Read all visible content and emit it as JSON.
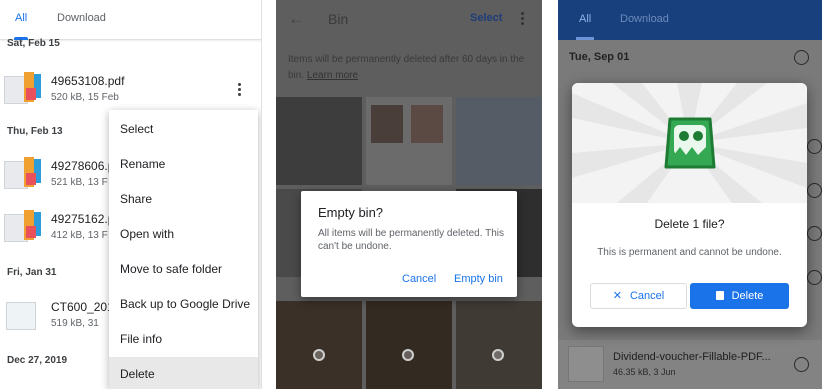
{
  "panel1": {
    "tabs": {
      "all": "All",
      "download": "Download"
    },
    "sections": [
      {
        "date": "Sat, Feb 15"
      },
      {
        "date": "Thu, Feb 13"
      },
      {
        "date": "Fri, Jan 31"
      },
      {
        "date": "Dec 27, 2019"
      }
    ],
    "files": [
      {
        "name": "49653108.pdf",
        "meta": "520 kB, 15 Feb"
      },
      {
        "name": "49278606.p",
        "meta": "521 kB, 13 F"
      },
      {
        "name": "49275162.p",
        "meta": "412 kB, 13 F"
      },
      {
        "name": "CT600_201",
        "meta": "519 kB, 31"
      }
    ],
    "menu": [
      "Select",
      "Rename",
      "Share",
      "Open with",
      "Move to safe folder",
      "Back up to Google Drive",
      "File info",
      "Delete"
    ]
  },
  "panel2": {
    "title": "Bin",
    "select": "Select",
    "note": "Items will be permanently deleted after 60 days in the bin.",
    "learn_more": "Learn more",
    "dialog": {
      "title": "Empty bin?",
      "body": "All items will be permanently deleted. This can't be undone.",
      "cancel": "Cancel",
      "confirm": "Empty bin"
    }
  },
  "panel3": {
    "tabs": {
      "all": "All",
      "download": "Download"
    },
    "date": "Tue, Sep 01",
    "file": {
      "name": "Dividend-voucher-Fillable-PDF...",
      "meta": "46.35 kB, 3 Jun"
    },
    "dialog": {
      "title": "Delete 1 file?",
      "body": "This is permanent and cannot be undone.",
      "cancel": "Cancel",
      "confirm": "Delete"
    }
  },
  "colors": {
    "accent": "#1a73e8",
    "dark_header": "#18407d",
    "hero_icon": "#34a853"
  }
}
